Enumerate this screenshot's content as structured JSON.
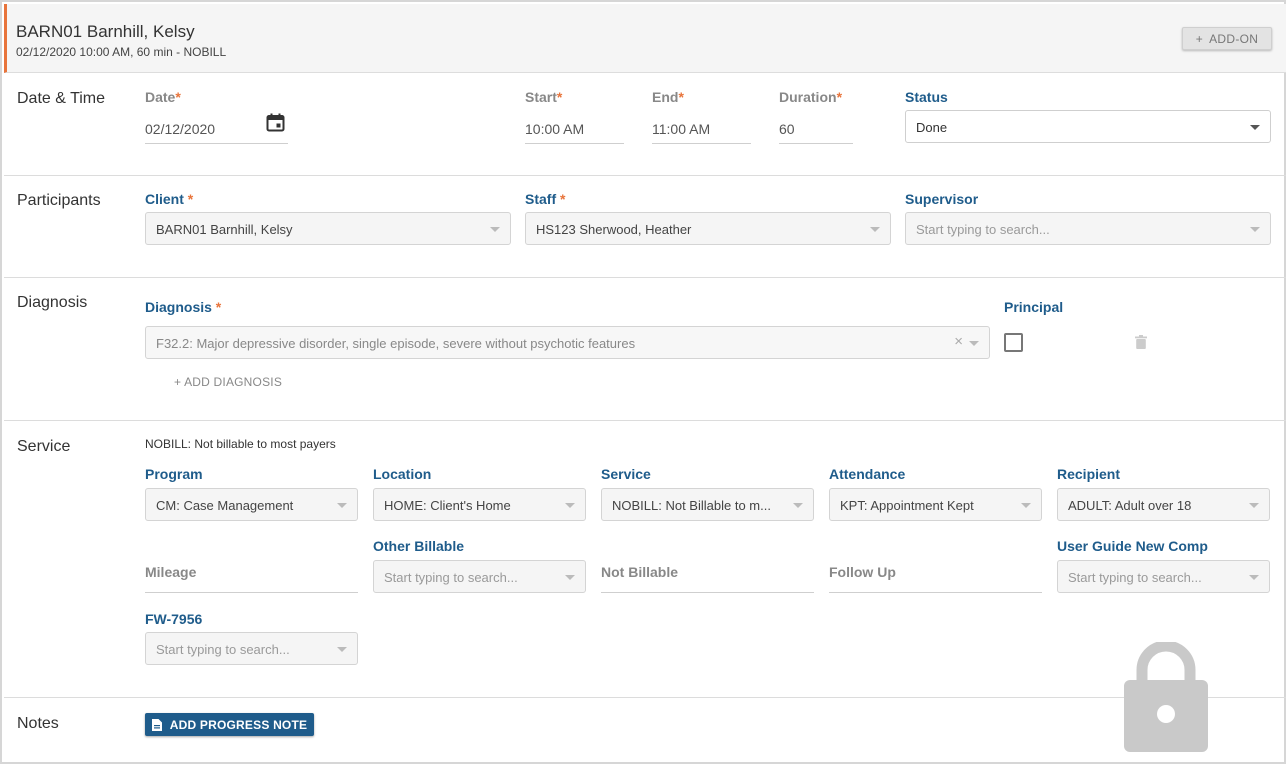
{
  "header": {
    "title": "BARN01 Barnhill, Kelsy",
    "subtitle": "02/12/2020 10:00 AM, 60 min - NOBILL",
    "addon_label": "ADD-ON",
    "addon_icon": "plus-icon"
  },
  "datetime": {
    "section_label": "Date & Time",
    "date_label": "Date",
    "date_value": "02/12/2020",
    "start_label": "Start",
    "start_value": "10:00 AM",
    "end_label": "End",
    "end_value": "11:00 AM",
    "duration_label": "Duration",
    "duration_value": "60",
    "status_label": "Status",
    "status_value": "Done",
    "required_mark": "*"
  },
  "participants": {
    "section_label": "Participants",
    "client_label": "Client ",
    "client_value": "BARN01 Barnhill, Kelsy",
    "staff_label": "Staff ",
    "staff_value": "HS123 Sherwood, Heather",
    "supervisor_label": "Supervisor",
    "supervisor_placeholder": "Start typing to search..."
  },
  "diagnosis": {
    "section_label": "Diagnosis",
    "diagnosis_label": "Diagnosis ",
    "diagnosis_value": "F32.2: Major depressive disorder, single episode, severe without psychotic features",
    "clear_glyph": "×",
    "principal_label": "Principal",
    "add_label": "+ ADD DIAGNOSIS"
  },
  "service": {
    "section_label": "Service",
    "nobill_text": "NOBILL: Not billable to most payers",
    "program_label": "Program",
    "program_value": "CM: Case Management",
    "location_label": "Location",
    "location_value": "HOME: Client's Home",
    "service_label": "Service",
    "service_value": "NOBILL: Not Billable to m...",
    "attendance_label": "Attendance",
    "attendance_value": "KPT: Appointment Kept",
    "recipient_label": "Recipient",
    "recipient_value": "ADULT: Adult over 18",
    "mileage_label": "Mileage",
    "other_billable_label": "Other Billable",
    "other_billable_placeholder": "Start typing to search...",
    "not_billable_label": "Not Billable",
    "follow_up_label": "Follow Up",
    "user_guide_label": "User Guide New Comp",
    "user_guide_placeholder": "Start typing to search...",
    "fw_label": "FW-7956",
    "fw_placeholder": "Start typing to search..."
  },
  "notes": {
    "section_label": "Notes",
    "add_note_label": "ADD PROGRESS NOTE",
    "add_note_icon": "document-icon"
  },
  "lock_icon": "lock-icon",
  "colors": {
    "accent_orange": "#e8743b",
    "label_blue": "#1f5c8b",
    "button_blue": "#1f5c8b"
  }
}
